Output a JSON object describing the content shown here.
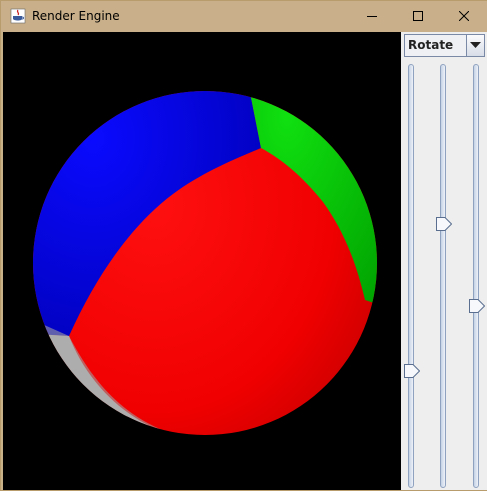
{
  "window": {
    "title": "Render Engine",
    "app_icon": "java-cup-icon",
    "controls": [
      "minimize-icon",
      "maximize-icon",
      "close-icon"
    ]
  },
  "render_view": {
    "background": "#000000",
    "scene": "sphere",
    "sphere_colors": {
      "red": "#ff0000",
      "blue": "#0000f0",
      "green": "#00cc00",
      "white": "#c8c8c8"
    }
  },
  "controls_panel": {
    "mode_select": {
      "selected": "Rotate",
      "arrow_icon": "chevron-down-icon"
    },
    "sliders": [
      {
        "name": "slider-1",
        "value_fraction": 0.27
      },
      {
        "name": "slider-2",
        "value_fraction": 0.63
      },
      {
        "name": "slider-3",
        "value_fraction": 0.43
      }
    ]
  }
}
